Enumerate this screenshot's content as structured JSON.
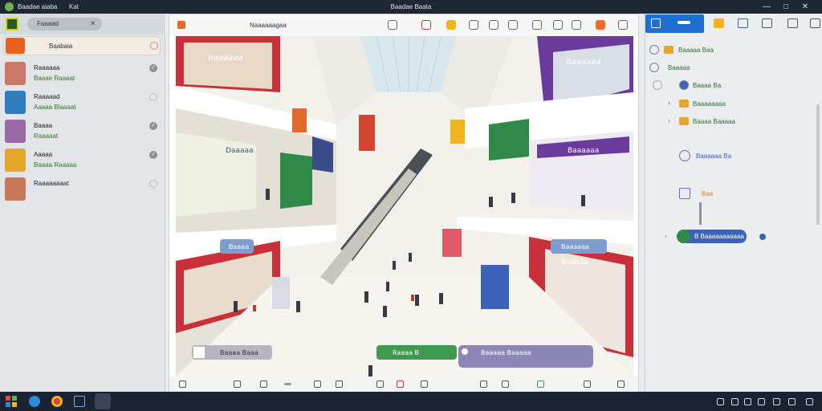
{
  "titlebar": {
    "app_name": "Baadae aiaba",
    "tab_label": "Kat",
    "window_title": "Baadae Baata",
    "controls": [
      "—",
      "□",
      "✕"
    ]
  },
  "left_panel": {
    "search_pill_label": "Faaaad",
    "search_pill_close": "✕",
    "selected_item": {
      "label": "Baabaia"
    },
    "items": [
      {
        "title": "Raaaaaa",
        "subtitle": "Baaae Raaaat",
        "status": "✓",
        "thumb_color": "#c9786a"
      },
      {
        "title": "Raaaaad",
        "subtitle": "Aaaaa Blaaaat",
        "status": "",
        "thumb_color": "#2f7fc0"
      },
      {
        "title": "Baaaa",
        "subtitle": "Raaaaat",
        "status": "✓",
        "thumb_color": "#9a6aa8"
      },
      {
        "title": "Aaaaa",
        "subtitle": "Baaaa Raaaaa",
        "status": "✓",
        "thumb_color": "#e3a72b"
      },
      {
        "title": "Raaaaaaaat",
        "subtitle": "",
        "status": "",
        "thumb_color": "#c97a5a"
      }
    ]
  },
  "viewer": {
    "title": "Naaaaaagaa",
    "mall_labels": {
      "sign_1": "Baaaaaa",
      "sign_2": "Daaaaa",
      "sign_3": "Baaaaaa",
      "sign_4": "Baaaaaa",
      "sign_5": "Baaaaa"
    },
    "pills": {
      "pill_left": "Baaaa",
      "pill_right": "Baaaaaa",
      "bottom_1": "Baaaa Baaa",
      "bottom_2": "Raaaa B",
      "bottom_3": "Baaaaa Baaaaa"
    }
  },
  "right_panel": {
    "tree": [
      {
        "label": "Baaaaa Baa"
      },
      {
        "label": "Baaaaa"
      },
      {
        "label": "Baaaa Ba"
      },
      {
        "label": "Baaaaaaaa"
      },
      {
        "label": "Baaaa Baaaaa"
      },
      {
        "label": "Baaaaaa Ba"
      },
      {
        "label": "Baa"
      }
    ],
    "active_pill": "B Baaaaaaaaaaa"
  },
  "colors": {
    "accent_blue": "#1f6fd1",
    "title_bar": "#1f2733",
    "taskbar": "#1a2331",
    "tree_text": "#2f6f3a"
  }
}
